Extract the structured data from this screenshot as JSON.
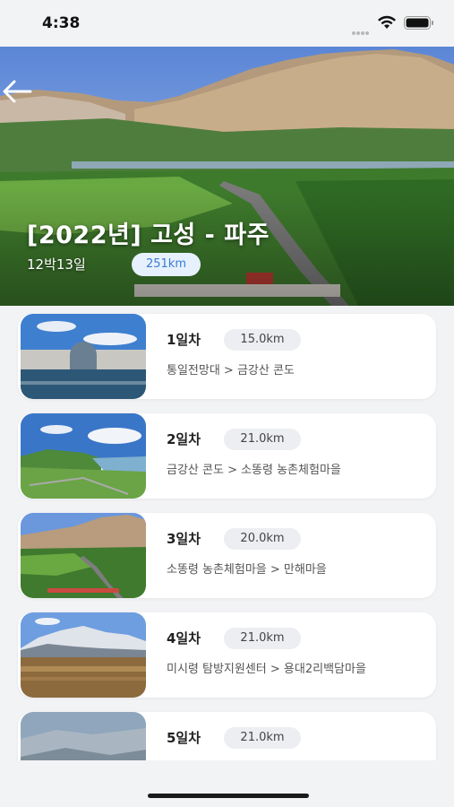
{
  "status": {
    "time": "4:38"
  },
  "header": {
    "title": "[2022년] 고성 - 파주",
    "days": "12박13일",
    "distance": "251km"
  },
  "days": [
    {
      "label": "1일차",
      "distance": "15.0km",
      "route": "통일전망대 > 금강산 콘도",
      "thumb_icon": "dam-landscape-thumbnail"
    },
    {
      "label": "2일차",
      "distance": "21.0km",
      "route": "금강산 콘도 > 소똥령 농촌체험마을",
      "thumb_icon": "coast-landscape-thumbnail"
    },
    {
      "label": "3일차",
      "distance": "20.0km",
      "route": "소똥령 농촌체험마을 > 만해마을",
      "thumb_icon": "mountain-road-thumbnail"
    },
    {
      "label": "4일차",
      "distance": "21.0km",
      "route": "미시령 탐방지원센터 > 용대2리백담마을",
      "thumb_icon": "snow-mountain-thumbnail"
    },
    {
      "label": "5일차",
      "distance": "21.0km",
      "route": "",
      "thumb_icon": "winter-forest-thumbnail"
    }
  ]
}
